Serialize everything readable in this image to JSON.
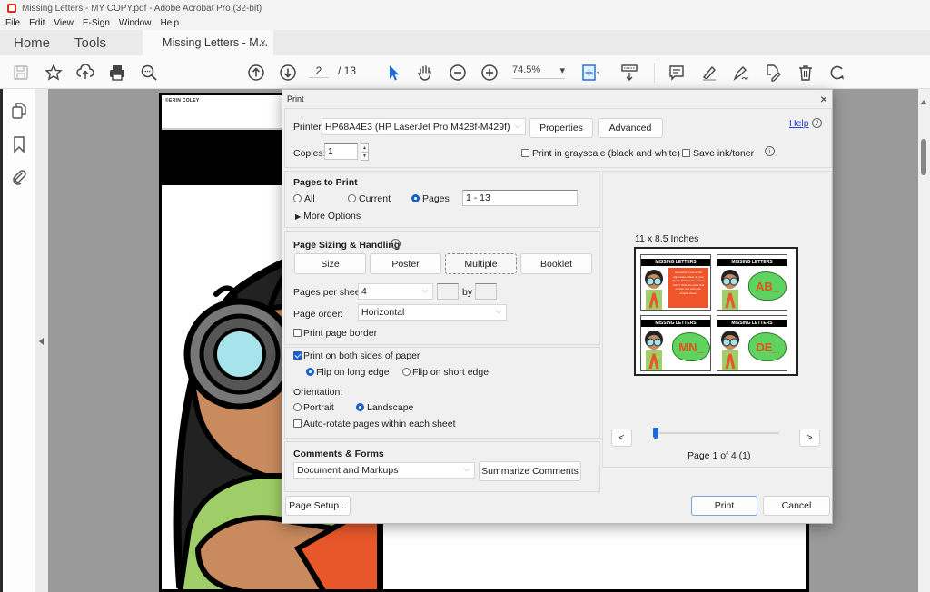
{
  "window": {
    "title": "Missing Letters - MY COPY.pdf - Adobe Acrobat Pro (32-bit)"
  },
  "menu": [
    "File",
    "Edit",
    "View",
    "E-Sign",
    "Window",
    "Help"
  ],
  "tabs": {
    "home": "Home",
    "tools": "Tools",
    "document": "Missing Letters - M...",
    "close": "×"
  },
  "toolbar": {
    "current_page": "2",
    "total_pages": "/ 13",
    "zoom": "74.5%",
    "zoom_chevron": "▾"
  },
  "document": {
    "credit": "©ERIN COLEY"
  },
  "dialog": {
    "title": "Print",
    "close": "×",
    "printer_label": "Printer:",
    "printer_value": "HP68A4E3 (HP LaserJet Pro M428f-M429f)",
    "properties": "Properties",
    "advanced": "Advanced",
    "help": "Help",
    "copies_label": "Copies:",
    "copies_value": "1",
    "grayscale_label": "Print in grayscale (black and white)",
    "grayscale_checked": false,
    "save_ink_label": "Save ink/toner",
    "save_ink_checked": false,
    "pages_to_print": {
      "heading": "Pages to Print",
      "options": [
        "All",
        "Current",
        "Pages"
      ],
      "selected": "Pages",
      "range": "1 - 13",
      "more_options": "More Options"
    },
    "sizing": {
      "heading": "Page Sizing & Handling",
      "buttons": [
        "Size",
        "Poster",
        "Multiple",
        "Booklet"
      ],
      "selected": "Multiple",
      "pages_per_sheet_label": "Pages per sheet:",
      "pages_per_sheet": "4",
      "by_label": "by",
      "page_order_label": "Page order:",
      "page_order": "Horizontal",
      "print_border_label": "Print page border",
      "print_border_checked": false
    },
    "duplex": {
      "both_sides_label": "Print on both sides of paper",
      "both_sides_checked": true,
      "flip_long": "Flip on long edge",
      "flip_short": "Flip on short edge",
      "flip_selected": "Flip on long edge",
      "orientation_label": "Orientation:",
      "portrait": "Portrait",
      "landscape": "Landscape",
      "orientation_selected": "Landscape",
      "auto_rotate_label": "Auto-rotate pages within each sheet",
      "auto_rotate_checked": false
    },
    "comments": {
      "heading": "Comments & Forms",
      "value": "Document and Markups",
      "summarize": "Summarize Comments"
    },
    "preview": {
      "paper_size": "11 x 8.5 Inches",
      "thumbnails": [
        {
          "header": "MISSING LETTERS",
          "content": "Directions: Look at the uppercase letters on your device. What is the missing letter? Write the letter that comes next onto your answer sheet."
        },
        {
          "header": "MISSING LETTERS",
          "content": "AB_"
        },
        {
          "header": "MISSING LETTERS",
          "content": "MN_"
        },
        {
          "header": "MISSING LETTERS",
          "content": "DE_"
        }
      ],
      "prev": "<",
      "next": ">",
      "page_status": "Page 1 of 4 (1)",
      "slider_position": 0
    },
    "page_setup": "Page Setup...",
    "print": "Print",
    "cancel": "Cancel"
  }
}
